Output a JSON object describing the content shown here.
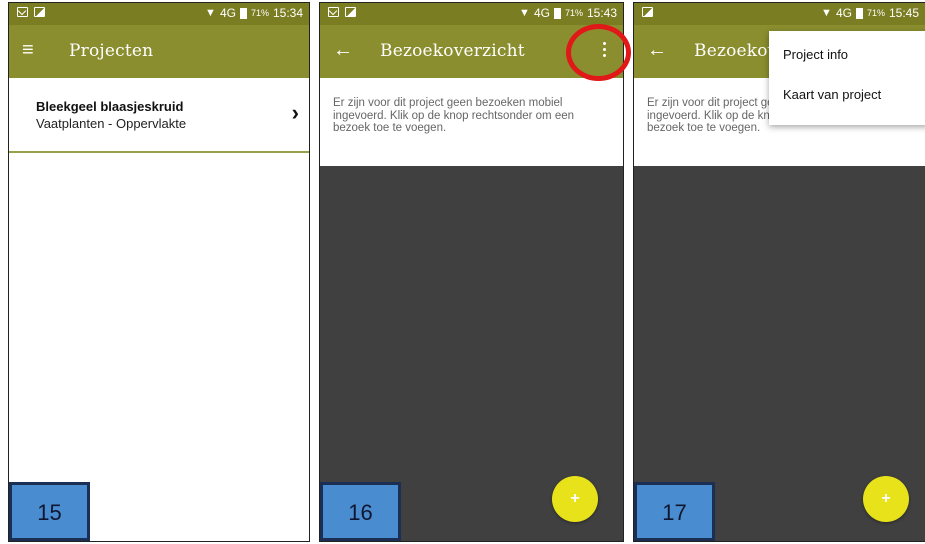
{
  "screens": [
    {
      "status": {
        "signal": "▼",
        "network": "4G",
        "battery": "71%",
        "time": "15:34"
      },
      "appbar": {
        "nav_icon": "menu-icon",
        "nav_glyph": "≡",
        "title": "Projecten"
      },
      "list": [
        {
          "title": "Bleekgeel blaasjeskruid",
          "subtitle": "Vaatplanten - Oppervlakte",
          "chevron": "›"
        }
      ],
      "step": "15"
    },
    {
      "status": {
        "signal": "▼",
        "network": "4G",
        "battery": "71%",
        "time": "15:43"
      },
      "appbar": {
        "nav_icon": "back-arrow-icon",
        "nav_glyph": "←",
        "title": "Bezoekoverzicht"
      },
      "info_text": "Er zijn voor dit project geen bezoeken mobiel ingevoerd. Klik op de knop rechtsonder om een bezoek toe te voegen.",
      "fab": "+",
      "step": "16"
    },
    {
      "status": {
        "signal": "▼",
        "network": "4G",
        "battery": "71%",
        "time": "15:45"
      },
      "appbar": {
        "nav_icon": "back-arrow-icon",
        "nav_glyph": "←",
        "title": "Bezoekov"
      },
      "info_text": "Er zijn voor dit project geen bezoeken mobiel ingevoerd. Klik op de knop rechtsonder om een bezoek toe te voegen.",
      "menu": [
        "Project info",
        "Kaart van project"
      ],
      "fab": "+",
      "step": "17"
    }
  ],
  "colors": {
    "statusbar": "#7a7d22",
    "appbar": "#8a8e2e",
    "fab": "#e8e21a",
    "highlight": "#e01818",
    "step_badge": "#4a8cd0"
  }
}
